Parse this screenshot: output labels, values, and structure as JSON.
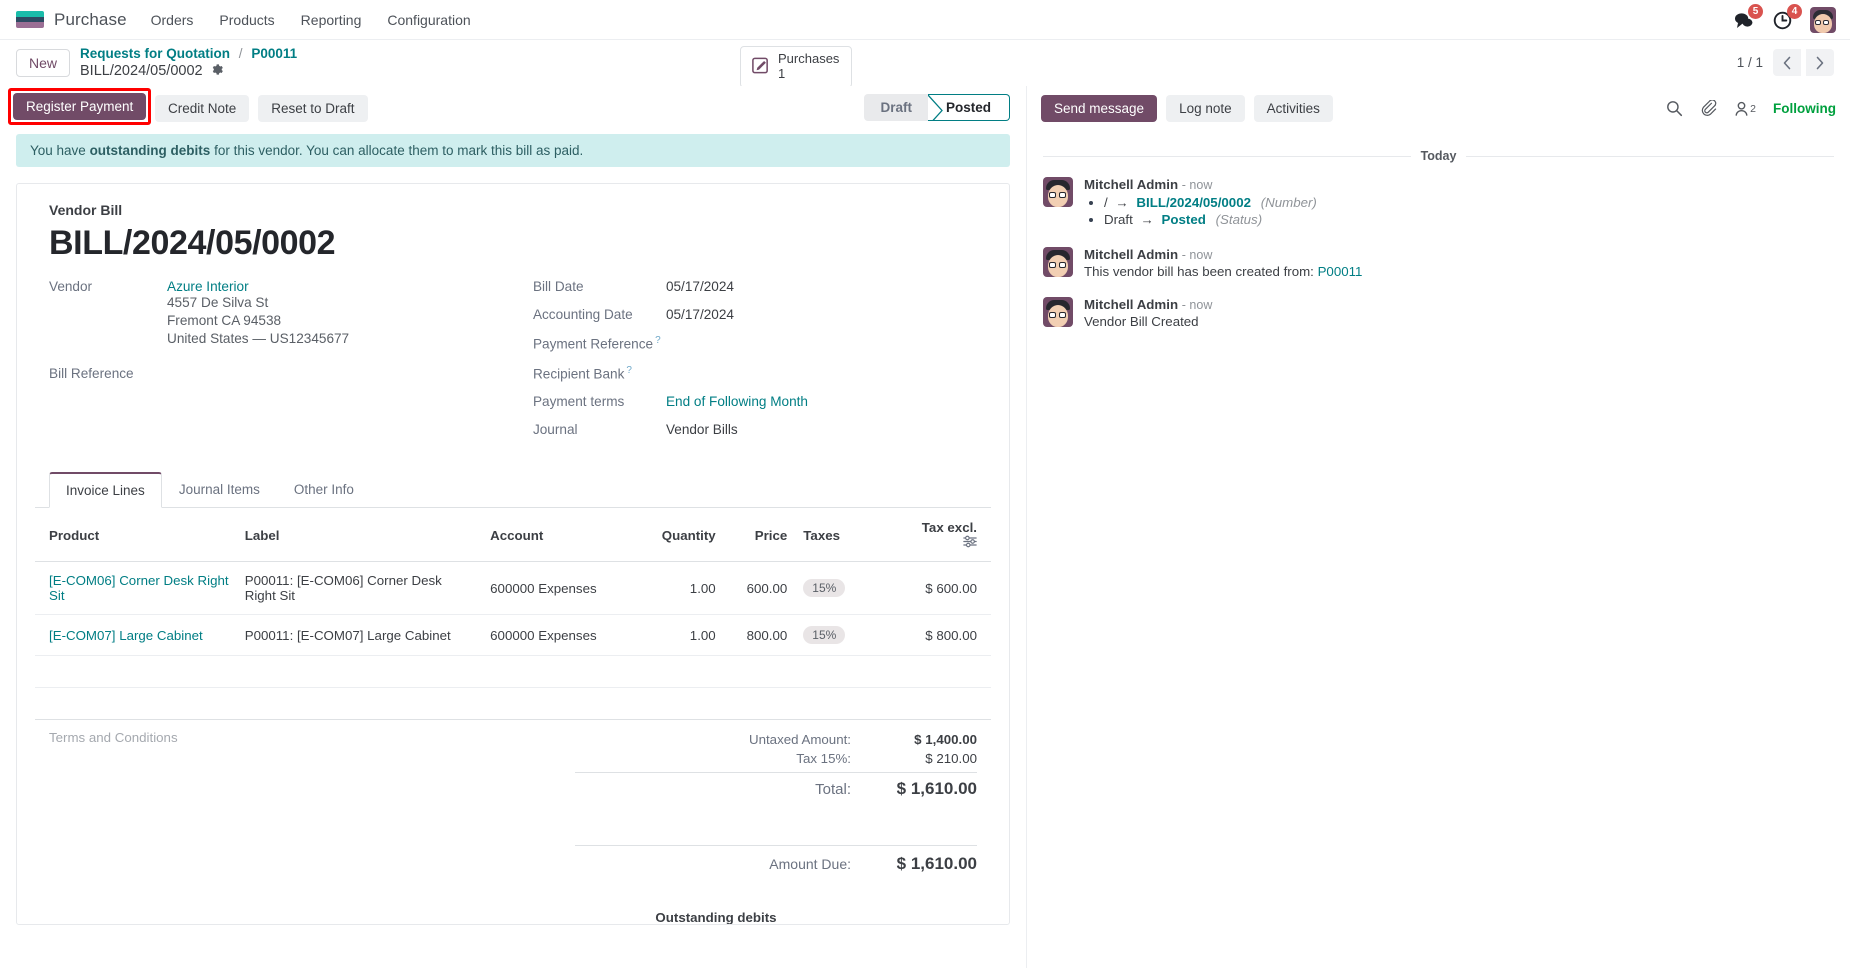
{
  "navbar": {
    "brand": "Purchase",
    "menu": [
      "Orders",
      "Products",
      "Reporting",
      "Configuration"
    ],
    "messages_badge": "5",
    "activities_badge": "4"
  },
  "control_panel": {
    "new_label": "New",
    "breadcrumb_parent": "Requests for Quotation",
    "breadcrumb_sep": "/",
    "breadcrumb_child": "P00011",
    "breadcrumb_record": "BILL/2024/05/0002",
    "smart_button": {
      "label": "Purchases",
      "value": "1"
    },
    "pager": "1 / 1"
  },
  "actions": {
    "register_payment": "Register Payment",
    "credit_note": "Credit Note",
    "reset_to_draft": "Reset to Draft",
    "status": [
      "Draft",
      "Posted"
    ],
    "status_active": "Posted"
  },
  "chatter_toolbar": {
    "send_message": "Send message",
    "log_note": "Log note",
    "activities": "Activities",
    "followers_count": "2",
    "following": "Following"
  },
  "alert": {
    "prefix": "You have ",
    "bold": "outstanding debits",
    "suffix": " for this vendor. You can allocate them to mark this bill as paid."
  },
  "document": {
    "type_label": "Vendor Bill",
    "title": "BILL/2024/05/0002",
    "vendor_label": "Vendor",
    "vendor_name": "Azure Interior",
    "vendor_address": [
      "4557 De Silva St",
      "Fremont CA 94538",
      "United States — US12345677"
    ],
    "bill_reference_label": "Bill Reference",
    "bill_reference_value": "",
    "right_fields": [
      {
        "label": "Bill Date",
        "value": "05/17/2024",
        "required": false,
        "help": false
      },
      {
        "label": "Accounting Date",
        "value": "05/17/2024",
        "required": false,
        "help": false
      },
      {
        "label": "Payment Reference",
        "value": "",
        "required": true,
        "help": true
      },
      {
        "label": "Recipient Bank",
        "value": "",
        "required": false,
        "help": true
      },
      {
        "label": "Payment terms",
        "value": "End of Following Month",
        "required": false,
        "help": false,
        "link": true
      },
      {
        "label": "Journal",
        "value": "Vendor Bills",
        "required": false,
        "help": false
      }
    ]
  },
  "notebook": {
    "tabs": [
      "Invoice Lines",
      "Journal Items",
      "Other Info"
    ],
    "active_tab": "Invoice Lines",
    "columns": [
      "Product",
      "Label",
      "Account",
      "Quantity",
      "Price",
      "Taxes",
      "Tax excl."
    ],
    "rows": [
      {
        "product": "[E-COM06] Corner Desk Right Sit",
        "label": "P00011: [E-COM06] Corner Desk Right Sit",
        "account": "600000 Expenses",
        "quantity": "1.00",
        "price": "600.00",
        "taxes": "15%",
        "tax_excl": "$ 600.00"
      },
      {
        "product": "[E-COM07] Large Cabinet",
        "label": "P00011: [E-COM07] Large Cabinet",
        "account": "600000 Expenses",
        "quantity": "1.00",
        "price": "800.00",
        "taxes": "15%",
        "tax_excl": "$ 800.00"
      }
    ]
  },
  "footer": {
    "terms_placeholder": "Terms and Conditions",
    "untaxed_label": "Untaxed Amount:",
    "untaxed_value": "$ 1,400.00",
    "tax_label": "Tax 15%:",
    "tax_value": "$ 210.00",
    "total_label": "Total:",
    "total_value": "$ 1,610.00",
    "due_label": "Amount Due:",
    "due_value": "$ 1,610.00",
    "outstanding_header": "Outstanding debits"
  },
  "chatter": {
    "day_separator": "Today",
    "messages": [
      {
        "author": "Mitchell Admin",
        "time": "- now",
        "body": "",
        "tracking": [
          {
            "old": "/",
            "new": "BILL/2024/05/0002",
            "field": "(Number)"
          },
          {
            "old": "Draft",
            "new": "Posted",
            "field": "(Status)"
          }
        ]
      },
      {
        "author": "Mitchell Admin",
        "time": "- now",
        "body_prefix": "This vendor bill has been created from: ",
        "body_link": "P00011",
        "tracking": []
      },
      {
        "author": "Mitchell Admin",
        "time": "- now",
        "body": "Vendor Bill Created",
        "tracking": []
      }
    ]
  },
  "colors": {
    "primary": "#714b67",
    "link": "#017e84",
    "alert_bg": "#cfeeee",
    "highlight": "#ff0000",
    "following": "#00a03e"
  }
}
